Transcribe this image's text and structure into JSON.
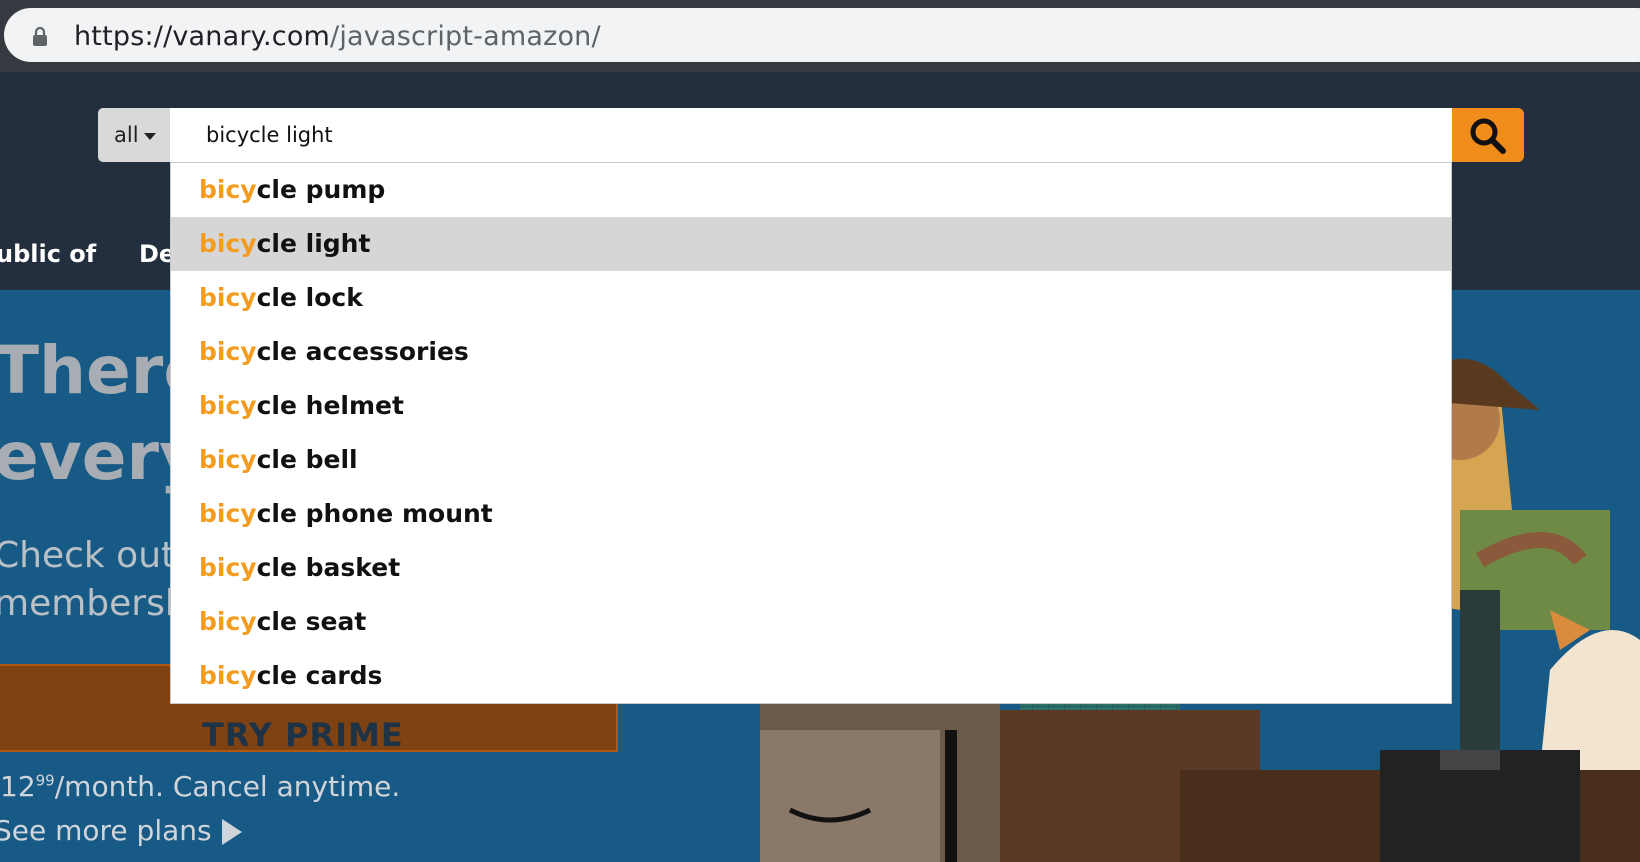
{
  "browser": {
    "url_host": "https://vanary.com",
    "url_path": "/javascript-amazon/"
  },
  "search": {
    "scope_label": "all",
    "query": "bicycle light",
    "accent": "#f08c1a"
  },
  "nav": {
    "items": [
      "ublic of",
      "De"
    ]
  },
  "hero": {
    "title_line1": "There",
    "title_line2": "every",
    "sub_line1": "Check out v",
    "sub_line2": "membersh",
    "cta": "TRY PRIME",
    "price_main": "12",
    "price_cents": "99",
    "price_rest": "/month. Cancel anytime.",
    "plans": "See more plans"
  },
  "suggestions": {
    "match_prefix": "bicy",
    "active_index": 1,
    "items": [
      "cle pump",
      "cle light",
      "cle lock",
      "cle accessories",
      "cle helmet",
      "cle bell",
      "cle phone mount",
      "cle basket",
      "cle seat",
      "cle cards"
    ],
    "highlight_color": "#f39c1f"
  }
}
